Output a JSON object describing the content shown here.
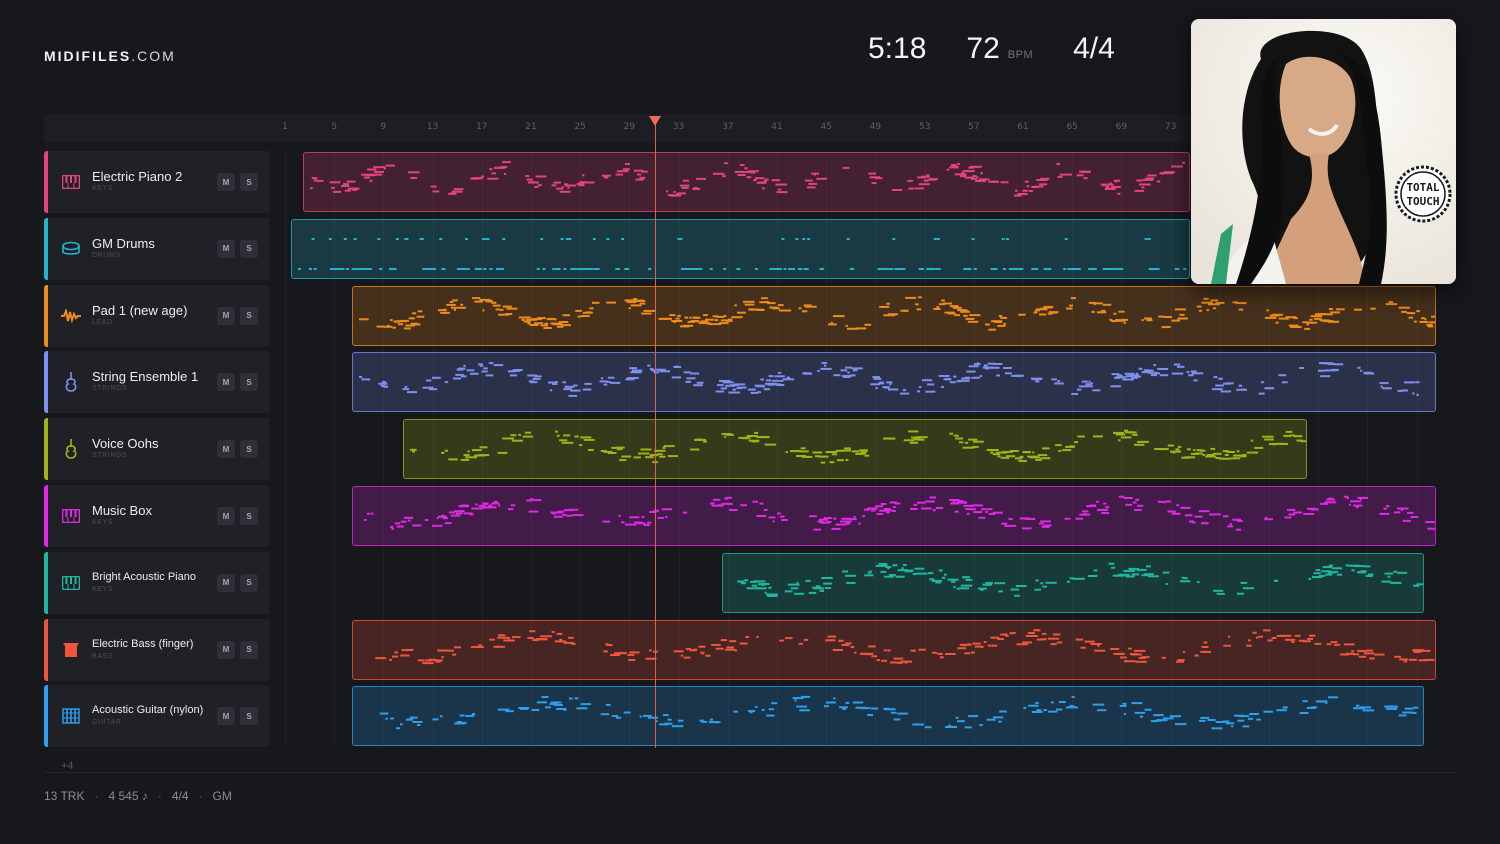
{
  "brand": {
    "name": "MIDIFILES",
    "tld": ".COM"
  },
  "transport": {
    "time": "5:18",
    "bpm": "72",
    "bpm_unit": "BPM",
    "signature": "4/4"
  },
  "cover": {
    "badge_line1": "TOTAL",
    "badge_line2": "TOUCH"
  },
  "ruler": {
    "bars": [
      "1",
      "5",
      "9",
      "13",
      "17",
      "21",
      "25",
      "29",
      "33",
      "37",
      "41",
      "45",
      "49",
      "53",
      "57",
      "61",
      "65",
      "69",
      "73"
    ]
  },
  "playhead": {
    "bar": 31
  },
  "tracks": [
    {
      "name": "Electric Piano 2",
      "category": "KEYS",
      "color": "#e5447a",
      "icon": "piano-keys-icon",
      "mute": "M",
      "solo": "S"
    },
    {
      "name": "GM Drums",
      "category": "DRUMS",
      "color": "#23b5cc",
      "icon": "drum-icon",
      "mute": "M",
      "solo": "S"
    },
    {
      "name": "Pad 1 (new age)",
      "category": "LEAD",
      "color": "#ef8a1c",
      "icon": "waveform-icon",
      "mute": "M",
      "solo": "S"
    },
    {
      "name": "String Ensemble 1",
      "category": "STRINGS",
      "color": "#7d8ff0",
      "icon": "violin-icon",
      "mute": "M",
      "solo": "S"
    },
    {
      "name": "Voice Oohs",
      "category": "STRINGS",
      "color": "#a0b418",
      "icon": "violin-icon",
      "mute": "M",
      "solo": "S"
    },
    {
      "name": "Music Box",
      "category": "KEYS",
      "color": "#e028e6",
      "icon": "piano-keys-icon",
      "mute": "M",
      "solo": "S"
    },
    {
      "name": "Bright Acoustic Piano",
      "category": "KEYS",
      "color": "#1eb89f",
      "icon": "piano-keys-icon",
      "mute": "M",
      "solo": "S"
    },
    {
      "name": "Electric Bass (finger)",
      "category": "BASS",
      "color": "#f0553d",
      "icon": "bass-icon",
      "mute": "M",
      "solo": "S"
    },
    {
      "name": "Acoustic Guitar (nylon)",
      "category": "GUITAR",
      "color": "#2b9ff0",
      "icon": "guitar-fretboard-icon",
      "mute": "M",
      "solo": "S"
    }
  ],
  "more_tracks": "+4",
  "footer": {
    "tracks": "13 TRK",
    "notes": "4 545 ♪",
    "signature": "4/4",
    "standard": "GM"
  }
}
